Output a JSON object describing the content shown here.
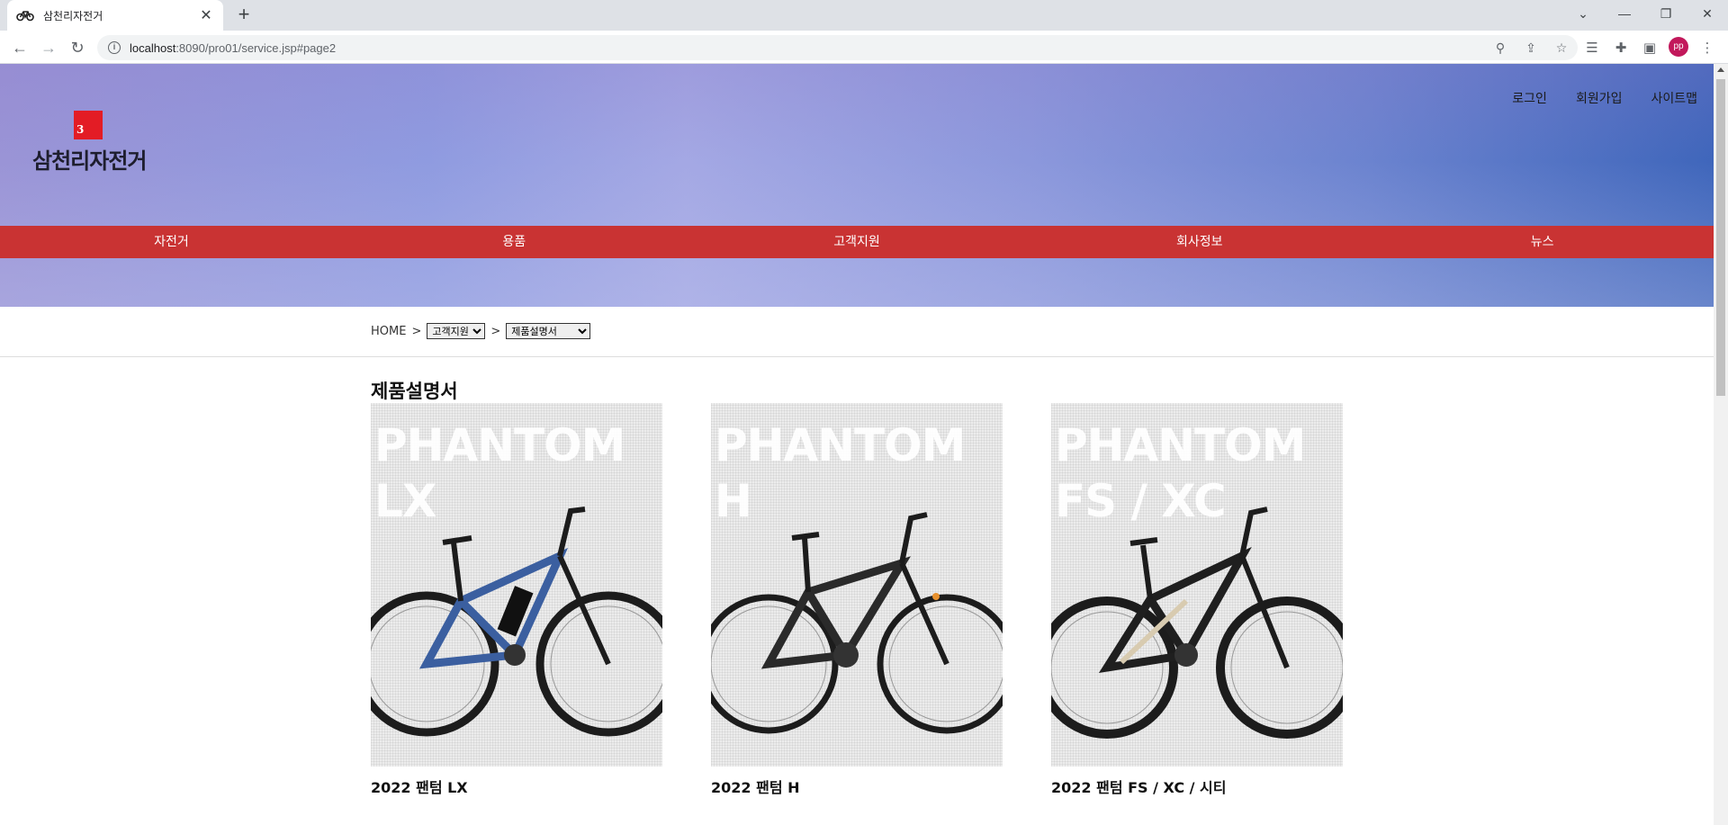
{
  "browser": {
    "tab_title": "삼천리자전거",
    "url_host": "localhost",
    "url_path": ":8090/pro01/service.jsp#page2",
    "profile_initials": "pp"
  },
  "header": {
    "logo_text": "삼천리자전거",
    "logo_mark": "3",
    "util_nav": [
      "로그인",
      "회원가입",
      "사이트맵"
    ],
    "main_nav": [
      "자전거",
      "용품",
      "고객지원",
      "회사정보",
      "뉴스"
    ]
  },
  "breadcrumb": {
    "home": "HOME",
    "separator": ">",
    "category_select": "고객지원",
    "page_select": "제품설명서"
  },
  "content": {
    "title": "제품설명서",
    "products": [
      {
        "model_line1": "PHANTOM",
        "model_line2": "LX",
        "caption": "2022 팬텀 LX",
        "frame_color": "#3b5fa0"
      },
      {
        "model_line1": "PHANTOM",
        "model_line2": "H",
        "caption": "2022 팬텀 H",
        "frame_color": "#2a2a2a"
      },
      {
        "model_line1": "PHANTOM",
        "model_line2": "FS / XC",
        "caption": "2022 팬텀 FS / XC / 시티",
        "frame_color": "#1f1f1f"
      }
    ]
  },
  "colors": {
    "nav_red": "#c93333",
    "logo_red": "#e31c25"
  }
}
